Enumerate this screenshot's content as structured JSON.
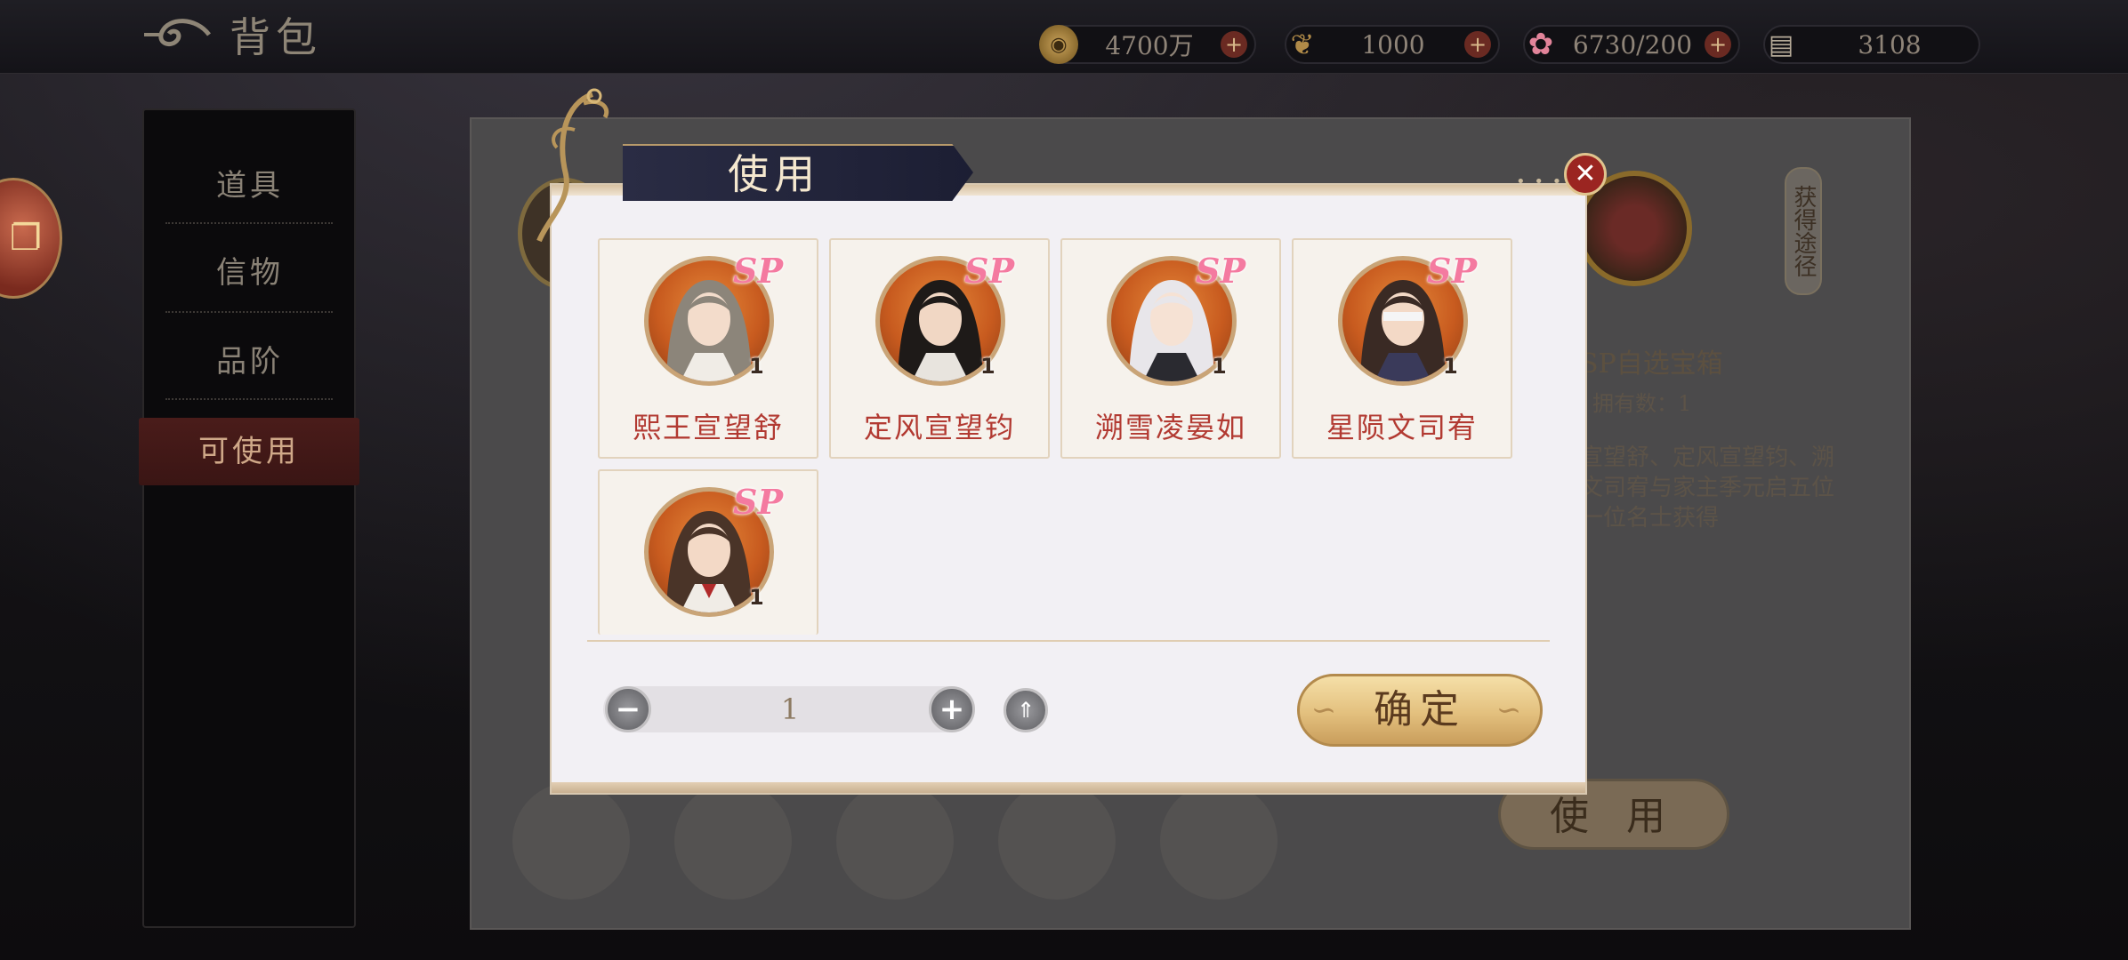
{
  "header": {
    "title": "背包"
  },
  "resources": [
    {
      "name": "coin",
      "value": "4700万",
      "icon": "coin-icon"
    },
    {
      "name": "feather",
      "value": "1000",
      "icon": "feather-icon"
    },
    {
      "name": "flower",
      "value": "6730/200",
      "icon": "flower-icon"
    },
    {
      "name": "card",
      "value": "3108",
      "icon": "card-icon"
    }
  ],
  "sidebar": {
    "items": [
      {
        "label": "道具"
      },
      {
        "label": "信物"
      },
      {
        "label": "品阶"
      },
      {
        "label": "可使用",
        "active": true
      }
    ]
  },
  "background_panel": {
    "item_name": "SP自选宝箱",
    "owned_label": "拥有数：1",
    "desc_line1": "宣望舒、定风宣望钧、溯",
    "desc_line2": "文司宥与家主季元启五位",
    "desc_line3": "一位名士获得",
    "acquire_label": "获得途径",
    "use_button": "使 用"
  },
  "dialog": {
    "title": "使用",
    "close_icon": "close-icon",
    "cards": [
      {
        "name": "熙王宣望舒",
        "badge": "SP",
        "count": "1",
        "hair": "#8c857a"
      },
      {
        "name": "定风宣望钧",
        "badge": "SP",
        "count": "1",
        "hair": "#1e1a18"
      },
      {
        "name": "溯雪凌晏如",
        "badge": "SP",
        "count": "1",
        "hair": "#e8e6ea"
      },
      {
        "name": "星陨文司宥",
        "badge": "SP",
        "count": "1",
        "hair": "#3a2a24"
      },
      {
        "name": "",
        "badge": "SP",
        "count": "1",
        "hair": "#4a3428"
      }
    ],
    "quantity": "1",
    "minus_icon": "minus-icon",
    "plus_icon": "plus-icon",
    "max_icon": "max-icon",
    "confirm_label": "确定"
  },
  "colors": {
    "accent_red": "#b23a32",
    "gold": "#e3c07e",
    "dialog_bg": "#f2f0f4"
  }
}
